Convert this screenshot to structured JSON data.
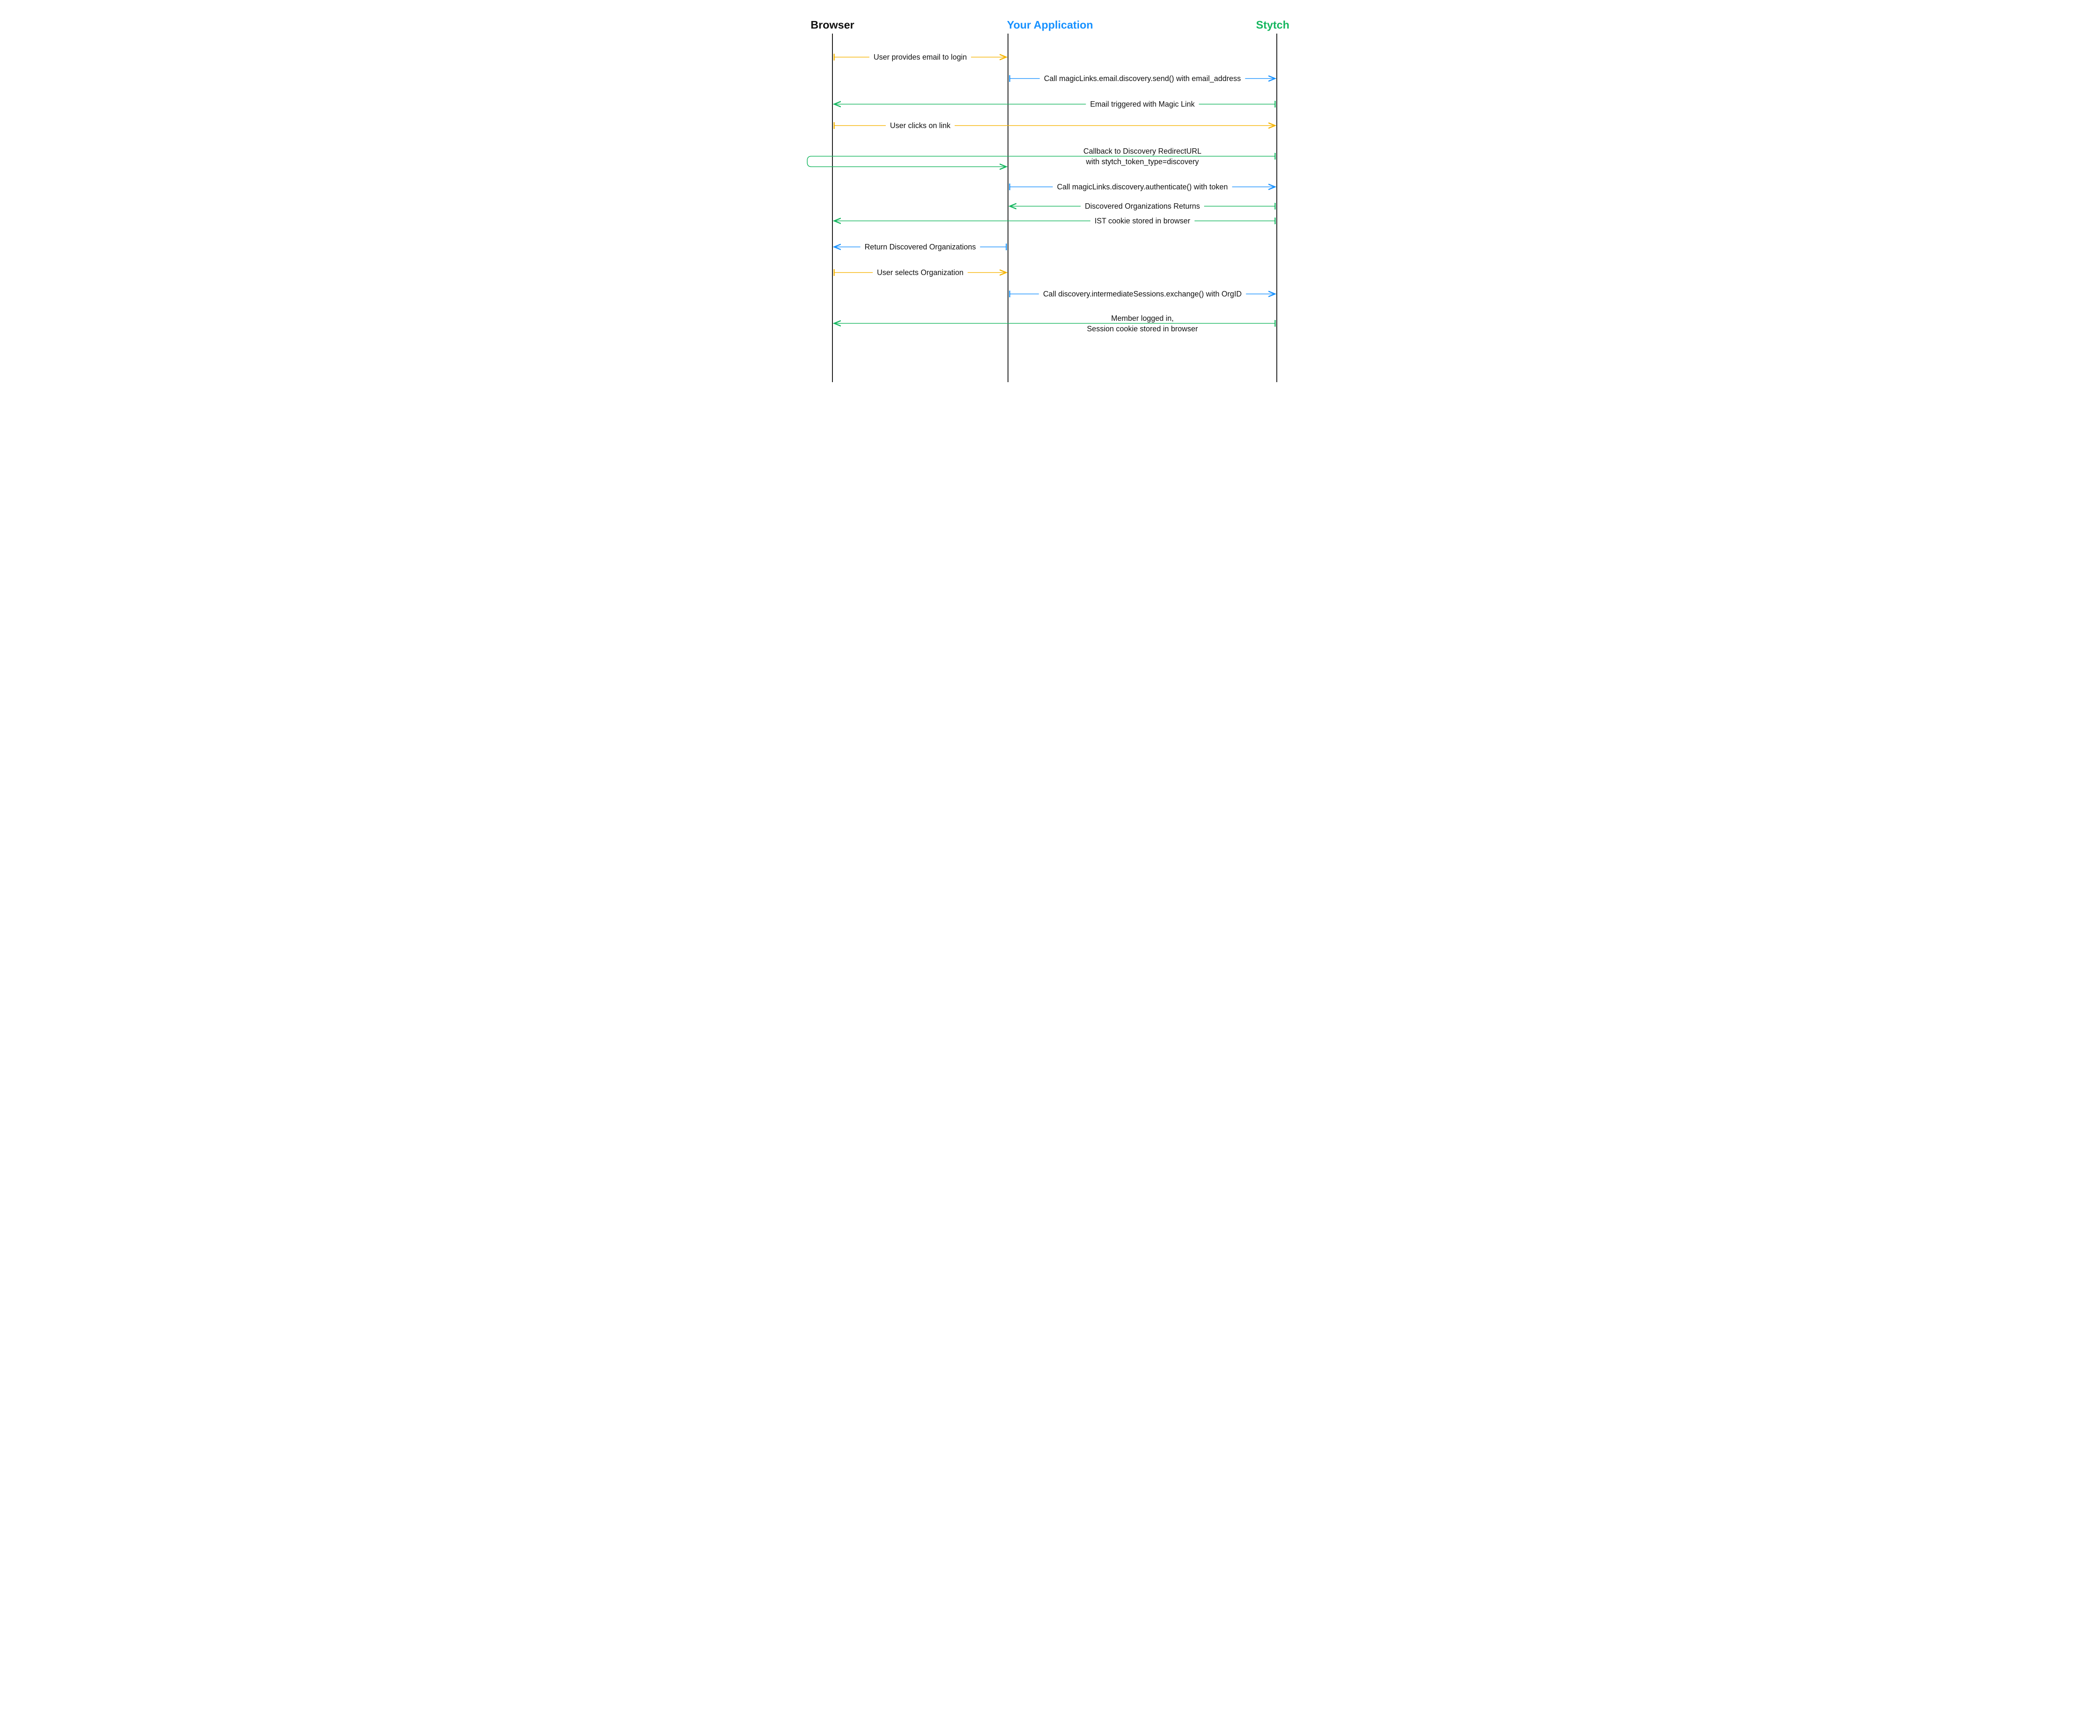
{
  "participants": {
    "browser": {
      "label": "Browser",
      "color": "#111111"
    },
    "app": {
      "label": "Your Application",
      "color": "#1791ff"
    },
    "stytch": {
      "label": "Stytch",
      "color": "#15b65f"
    }
  },
  "messages": {
    "m1": "User provides email to login",
    "m2": "Call magicLinks.email.discovery.send() with email_address",
    "m3": "Email triggered with Magic Link",
    "m4": "User clicks on link",
    "m5a": "Callback to Discovery RedirectURL",
    "m5b": "with stytch_token_type=discovery",
    "m6": "Call magicLinks.discovery.authenticate() with token",
    "m7": "Discovered Organizations Returns",
    "m8": "IST cookie stored in browser",
    "m9": "Return Discovered Organizations",
    "m10": "User selects Organization",
    "m11": "Call discovery.intermediateSessions.exchange() with OrgID",
    "m12a": "Member logged in,",
    "m12b": "Session cookie stored in browser"
  },
  "colors": {
    "orange": "#f5b400",
    "blue": "#1791ff",
    "green": "#15b65f",
    "lifeline": "#111111"
  }
}
